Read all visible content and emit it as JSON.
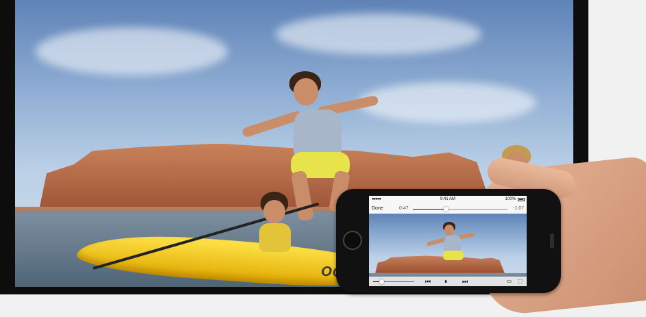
{
  "video_player": {
    "done_label": "Done",
    "elapsed_time": "0:47",
    "remaining_time": "-1:07",
    "progress_fraction": 0.35,
    "volume_fraction": 0.2
  },
  "status_bar": {
    "signal": "●●●●● ",
    "time": "9:41 AM",
    "battery": "100%"
  },
  "kayak_text": "OCEAN",
  "icons": {
    "rewind": "⏮",
    "pause": "⏸",
    "fast_forward": "⏭",
    "airplay": "▭",
    "fullscreen": "⬚"
  },
  "colors": {
    "kayak": "#f2c617",
    "cliff": "#b96a44",
    "sky": "#8cabd2"
  }
}
